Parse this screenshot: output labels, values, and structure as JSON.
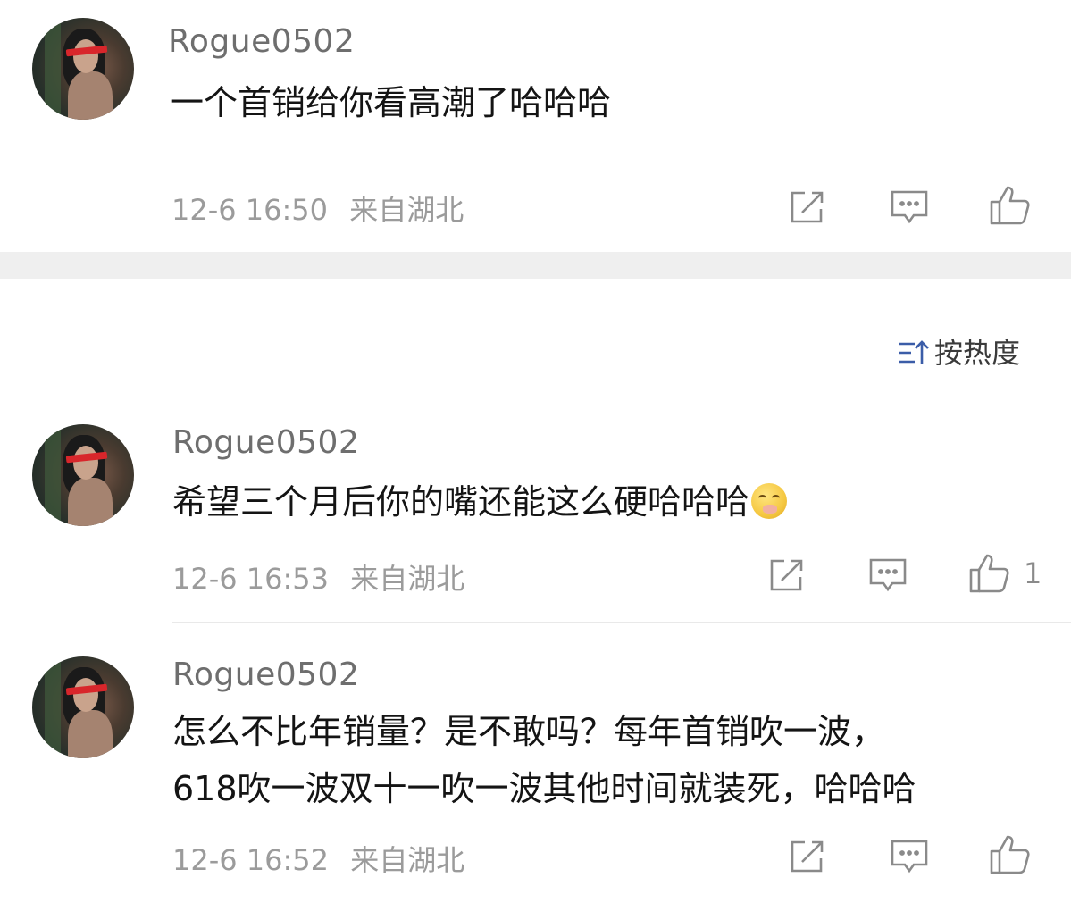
{
  "top_comment": {
    "username": "Rogue0502",
    "text": "一个首销给你看高潮了哈哈哈",
    "time": "12-6 16:50",
    "location": "来自湖北"
  },
  "sort": {
    "icon": "sort-icon",
    "label": "按热度"
  },
  "replies": [
    {
      "username": "Rogue0502",
      "text": "希望三个月后你的嘴还能这么硬哈哈哈",
      "emoji": "smirk-emoji",
      "time": "12-6 16:53",
      "location": "来自湖北",
      "likes": "1"
    },
    {
      "username": "Rogue0502",
      "text_line1": "怎么不比年销量？是不敢吗？每年首销吹一波，",
      "text_line2": "618吹一波双十一吹一波其他时间就装死，哈哈哈",
      "time": "12-6 16:52",
      "location": "来自湖北"
    }
  ],
  "icons": {
    "share": "share-icon",
    "comment": "comment-icon",
    "like": "thumbs-up-icon"
  },
  "colors": {
    "username": "#6e6e6e",
    "meta": "#9b9b9b",
    "divider": "#efefef"
  }
}
